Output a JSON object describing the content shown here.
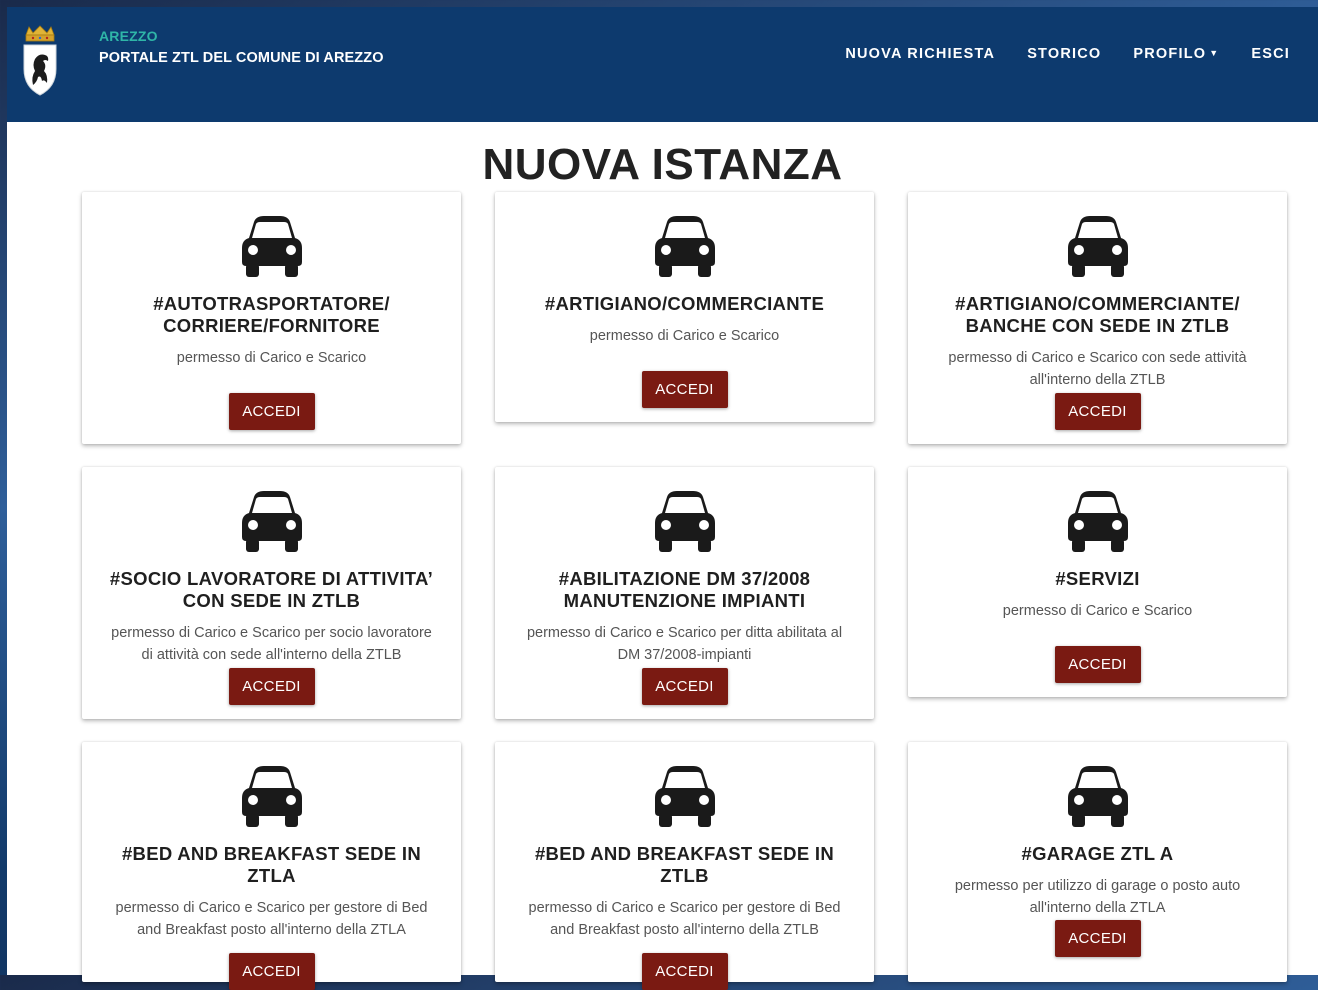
{
  "header": {
    "brand_small": "AREZZO",
    "brand_main": "PORTALE ZTL DEL COMUNE DI AREZZO",
    "logo_icon": "arezzo-coat-of-arms",
    "nav": [
      {
        "label": "NUOVA RICHIESTA"
      },
      {
        "label": "STORICO"
      },
      {
        "label": "PROFILO",
        "has_caret": true
      },
      {
        "label": "ESCI"
      }
    ]
  },
  "main": {
    "title": "NUOVA ISTANZA",
    "button_label": "ACCEDI",
    "card_icon": "car-icon",
    "cards": [
      {
        "title_1": "#AUTOTRASPORTATORE/",
        "title_2": "CORRIERE/FORNITORE",
        "desc_1": "permesso di Carico e Scarico",
        "desc_2": "",
        "button": "ACCEDI"
      },
      {
        "title_1": "#ARTIGIANO/COMMERCIANTE",
        "title_2": "",
        "desc_1": "permesso di Carico e Scarico",
        "desc_2": "",
        "button": "ACCEDI"
      },
      {
        "title_1": "#ARTIGIANO/COMMERCIANTE/",
        "title_2": "BANCHE CON SEDE IN ZTLB",
        "desc_1": "permesso di Carico e Scarico con sede attività",
        "desc_2": "all'interno della ZTLB",
        "button": "ACCEDI"
      },
      {
        "title_1": "#SOCIO LAVORATORE DI ATTIVITA’",
        "title_2": "CON SEDE IN ZTLB",
        "desc_1": "permesso di Carico e Scarico per socio lavoratore",
        "desc_2": "di attività con sede all'interno della ZTLB",
        "button": "ACCEDI"
      },
      {
        "title_1": "#ABILITAZIONE DM 37/2008",
        "title_2": "MANUTENZIONE IMPIANTI",
        "desc_1": "permesso di Carico e Scarico per ditta abilitata al",
        "desc_2": "DM 37/2008-impianti",
        "button": "ACCEDI"
      },
      {
        "title_1": "#SERVIZI",
        "title_2": "",
        "desc_1": "permesso di Carico e Scarico",
        "desc_2": "",
        "button": "ACCEDI"
      },
      {
        "title_1": "#BED AND BREAKFAST SEDE IN",
        "title_2": "ZTLA",
        "desc_1": "permesso di Carico e Scarico per gestore di Bed",
        "desc_2": "and Breakfast posto all'interno della ZTLA",
        "button": "ACCEDI"
      },
      {
        "title_1": "#BED AND BREAKFAST SEDE IN",
        "title_2": "ZTLB",
        "desc_1": "permesso di Carico e Scarico per gestore di Bed",
        "desc_2": "and Breakfast posto all'interno della ZTLB",
        "button": "ACCEDI"
      },
      {
        "title_1": "#GARAGE ZTL A",
        "title_2": "",
        "desc_1": "permesso per utilizzo di garage o posto auto",
        "desc_2": "all'interno della ZTLA",
        "button": "ACCEDI"
      }
    ]
  },
  "colors": {
    "header_bg": "#0d3a6e",
    "brand_accent": "#2fb6a8",
    "button_bg": "#7a1a12"
  }
}
